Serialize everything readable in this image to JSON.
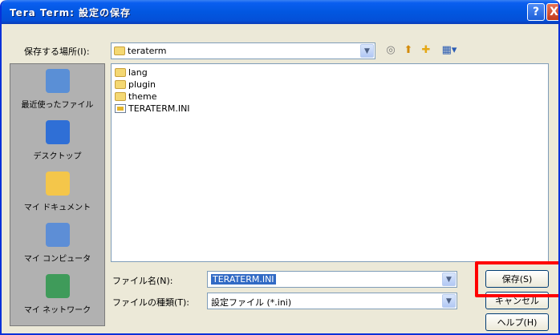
{
  "window": {
    "title": "Tera Term: 設定の保存"
  },
  "titlebar": {
    "help_glyph": "?",
    "close_glyph": "X"
  },
  "save_in": {
    "label": "保存する場所(I):",
    "value": "teraterm"
  },
  "places": [
    {
      "label": "最近使ったファイル",
      "icon": "recent-icon",
      "color": "#5a8fd6"
    },
    {
      "label": "デスクトップ",
      "icon": "desktop-icon",
      "color": "#2f6fd6"
    },
    {
      "label": "マイ ドキュメント",
      "icon": "my-documents-icon",
      "color": "#f4c64a"
    },
    {
      "label": "マイ コンピュータ",
      "icon": "my-computer-icon",
      "color": "#5d8ed6"
    },
    {
      "label": "マイ ネットワーク",
      "icon": "my-network-icon",
      "color": "#3f9b5a"
    }
  ],
  "files": [
    {
      "name": "lang",
      "type": "folder"
    },
    {
      "name": "plugin",
      "type": "folder"
    },
    {
      "name": "theme",
      "type": "folder"
    },
    {
      "name": "TERATERM.INI",
      "type": "file"
    }
  ],
  "filename": {
    "label": "ファイル名(N):",
    "value": "TERATERM.INI"
  },
  "filetype": {
    "label": "ファイルの種類(T):",
    "value": "設定ファイル (*.ini)"
  },
  "buttons": {
    "save": "保存(S)",
    "cancel": "キャンセル",
    "help": "ヘルプ(H)"
  },
  "colors": {
    "title_bar": "#0257e0",
    "highlight": "#ff0000",
    "selection": "#316ac5"
  }
}
